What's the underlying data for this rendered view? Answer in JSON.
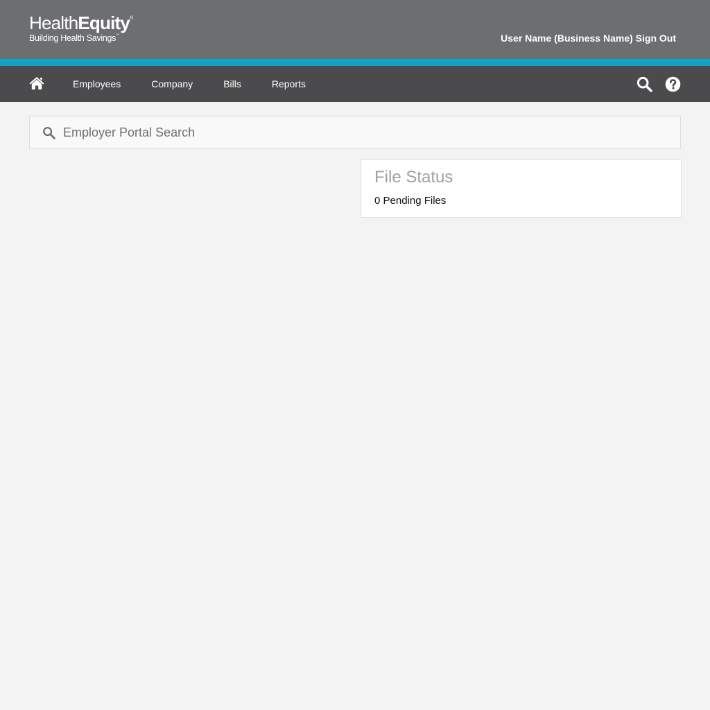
{
  "brand": {
    "name_light": "Health",
    "name_bold": "Equity",
    "registered_mark": "®",
    "tagline": "Building Health Savings",
    "tagline_mark": "™"
  },
  "header": {
    "user_label": "User Name (Business Name)",
    "sign_out_label": "Sign Out"
  },
  "colors": {
    "header_bg": "#6d6e71",
    "accent": "#12a3c4",
    "nav_bg": "#4b4b4d",
    "page_bg": "#f3f3f3"
  },
  "nav": {
    "home_icon": "home-icon",
    "items": [
      {
        "label": "Employees"
      },
      {
        "label": "Company"
      },
      {
        "label": "Bills"
      },
      {
        "label": "Reports"
      }
    ],
    "search_icon": "search-icon",
    "help_icon": "help-icon"
  },
  "search": {
    "icon": "search-icon",
    "placeholder": "Employer Portal Search",
    "value": ""
  },
  "file_status": {
    "title": "File Status",
    "pending_text": "0 Pending Files"
  }
}
